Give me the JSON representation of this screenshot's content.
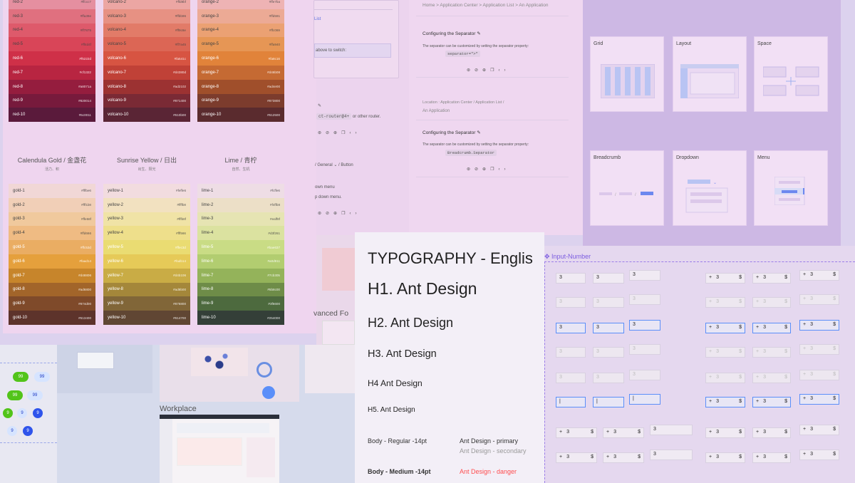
{
  "palettes": [
    {
      "key": "red",
      "items": [
        [
          "red-2",
          "#ffccc7"
        ],
        [
          "red-3",
          "#ffa39e"
        ],
        [
          "red-4",
          "#ff7875"
        ],
        [
          "red-5",
          "#ff4d4f"
        ],
        [
          "red-6",
          "#f5222d"
        ],
        [
          "red-7",
          "#cf1322"
        ],
        [
          "red-8",
          "#a8071a"
        ],
        [
          "red-9",
          "#820014"
        ],
        [
          "red-10",
          "#5c0011"
        ]
      ]
    },
    {
      "key": "volcano",
      "items": [
        [
          "volcano-2",
          "#ffd8bf"
        ],
        [
          "volcano-3",
          "#ffbb96"
        ],
        [
          "volcano-4",
          "#ff9c6e"
        ],
        [
          "volcano-5",
          "#ff7a45"
        ],
        [
          "volcano-6",
          "#fa541c"
        ],
        [
          "volcano-7",
          "#d4380d"
        ],
        [
          "volcano-8",
          "#ad2102"
        ],
        [
          "volcano-9",
          "#871400"
        ],
        [
          "volcano-10",
          "#610b00"
        ]
      ]
    },
    {
      "key": "orange",
      "items": [
        [
          "orange-2",
          "#ffe7ba"
        ],
        [
          "orange-3",
          "#ffd591"
        ],
        [
          "orange-4",
          "#ffc069"
        ],
        [
          "orange-5",
          "#ffa940"
        ],
        [
          "orange-6",
          "#fa8c16"
        ],
        [
          "orange-7",
          "#d46b08"
        ],
        [
          "orange-8",
          "#ad4e00"
        ],
        [
          "orange-9",
          "#873800"
        ],
        [
          "orange-10",
          "#612500"
        ]
      ]
    },
    {
      "key": "gold",
      "title": "Calendula Gold / 金盏花",
      "sub": "活力、积",
      "items": [
        [
          "gold-1",
          "#fffbe6"
        ],
        [
          "gold-2",
          "#fff1b8"
        ],
        [
          "gold-3",
          "#ffe58f"
        ],
        [
          "gold-4",
          "#ffd666"
        ],
        [
          "gold-5",
          "#ffc53d"
        ],
        [
          "gold-6",
          "#faad14"
        ],
        [
          "gold-7",
          "#d48806"
        ],
        [
          "gold-8",
          "#ad6800"
        ],
        [
          "gold-9",
          "#874d00"
        ],
        [
          "gold-10",
          "#613400"
        ]
      ]
    },
    {
      "key": "yellow",
      "title": "Sunrise Yellow / 日出",
      "sub": "出生、阳光",
      "items": [
        [
          "yellow-1",
          "#feffe6"
        ],
        [
          "yellow-2",
          "#ffffb8"
        ],
        [
          "yellow-3",
          "#fffb8f"
        ],
        [
          "yellow-4",
          "#fff566"
        ],
        [
          "yellow-5",
          "#ffec3d"
        ],
        [
          "yellow-6",
          "#fadb14"
        ],
        [
          "yellow-7",
          "#d4b106"
        ],
        [
          "yellow-8",
          "#ad8b00"
        ],
        [
          "yellow-9",
          "#876800"
        ],
        [
          "yellow-10",
          "#614700"
        ]
      ]
    },
    {
      "key": "lime",
      "title": "Lime / 青柠",
      "sub": "自然、生机",
      "items": [
        [
          "lime-1",
          "#fcffe6"
        ],
        [
          "lime-2",
          "#f4ffb8"
        ],
        [
          "lime-3",
          "#eaff8f"
        ],
        [
          "lime-4",
          "#d3f261"
        ],
        [
          "lime-5",
          "#bae637"
        ],
        [
          "lime-6",
          "#a0d911"
        ],
        [
          "lime-7",
          "#7cb305"
        ],
        [
          "lime-8",
          "#5b8c00"
        ],
        [
          "lime-9",
          "#3f6600"
        ],
        [
          "lime-10",
          "#254000"
        ]
      ]
    }
  ],
  "bc_fragment": {
    "list": "List",
    "switch": "above to switch:",
    "router_code": "ct-router@4+",
    "router_rest": "or other router.",
    "general": "/ General",
    "button": "Button",
    "down_menu": "own menu",
    "down_menu2": "p down menu."
  },
  "mid": {
    "crumb1": [
      "Home",
      ">",
      "Application Center",
      ">",
      "Application List",
      ">",
      "An Application"
    ],
    "sep_title": "Configuring the Separator",
    "sep_desc": "The separator can be customized by setting the separator property:",
    "sep_code": "separator=\">\"",
    "crumb2": [
      "Location",
      ":",
      "Application Center",
      "/",
      "Application List",
      "/"
    ],
    "crumb2_last": "An Application",
    "sep_title2": "Configuring the Separator",
    "sep_desc2": "The separator can be customized by setting the separator property:",
    "sep_code2": "Breadcrumb.Separator"
  },
  "components": [
    "Grid",
    "Layout",
    "Space",
    "Breadcrumb",
    "Dropdown",
    "Menu"
  ],
  "workplace": "Workplace",
  "advanced": "vanced Fo",
  "typography": {
    "title": "TYPOGRAPHY - Englis",
    "h1": "H1. Ant Design",
    "h2": "H2. Ant Design",
    "h3": "H3. Ant Design",
    "h4": "H4 Ant Design",
    "h5": "H5. Ant Design",
    "body_regular": "Body - Regular -14pt",
    "body_medium": "Body - Medium -14pt",
    "primary": "Ant Design - primary",
    "secondary": "Ant Design - secondary",
    "danger": "Ant Design - danger"
  },
  "input_number": {
    "label": "Input-Number",
    "value": "3",
    "plus": "+",
    "dollar": "$"
  },
  "badges": [
    "99",
    "99",
    "99",
    "99",
    "9",
    "9",
    "9",
    "9",
    "9"
  ]
}
